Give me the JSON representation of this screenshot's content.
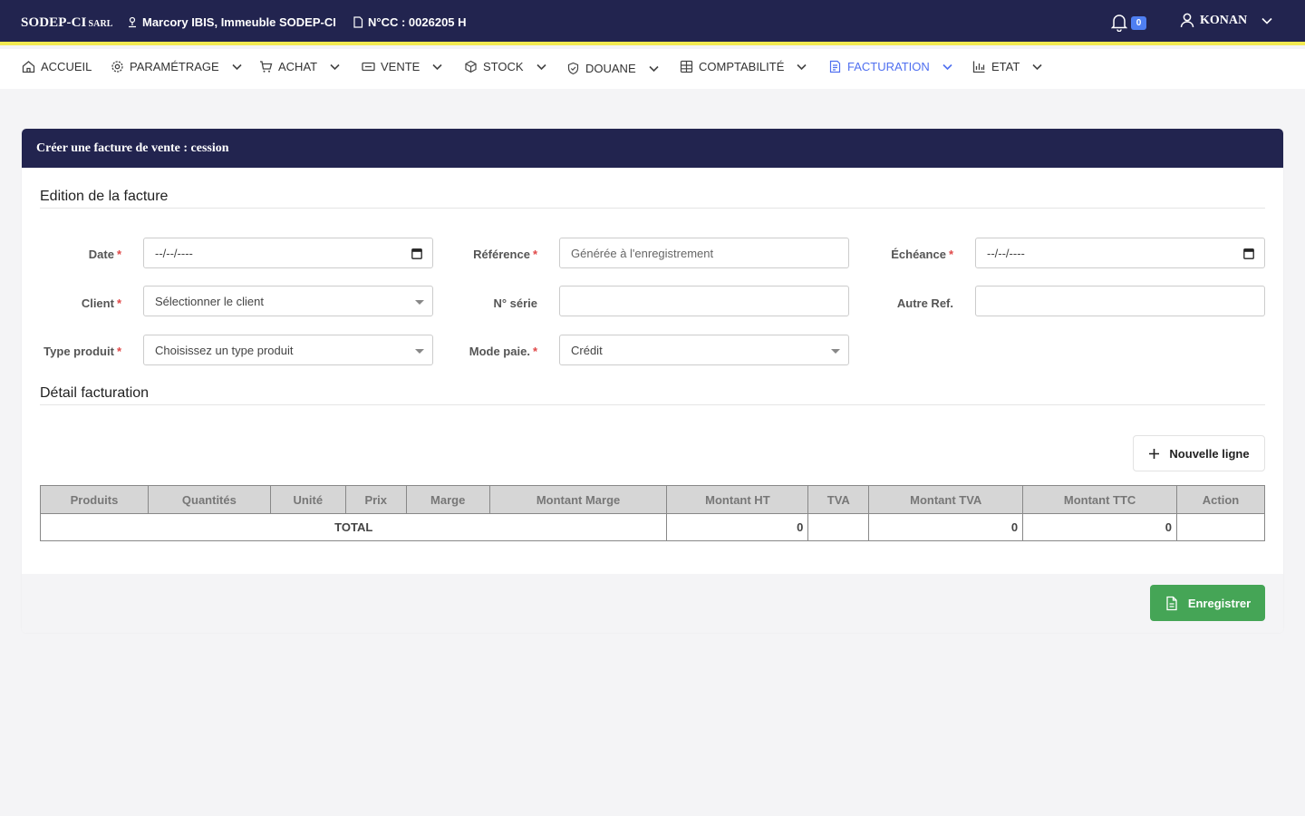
{
  "topbar": {
    "brand": "SODEP-CI",
    "brand_suffix": "SARL",
    "address": "Marcory IBIS, Immeuble SODEP-CI",
    "ncc": "N°CC : 0026205 H",
    "notification_count": "0",
    "user_name": "KONAN"
  },
  "nav": {
    "items": [
      {
        "label": "ACCUEIL",
        "icon": "home-icon"
      },
      {
        "label": "PARAMÉTRAGE",
        "icon": "settings-icon"
      },
      {
        "label": "ACHAT",
        "icon": "cart-icon"
      },
      {
        "label": "VENTE",
        "icon": "ticket-icon"
      },
      {
        "label": "STOCK",
        "icon": "box-icon"
      },
      {
        "label": "DOUANE",
        "icon": "shield-icon"
      },
      {
        "label": "COMPTABILITÉ",
        "icon": "calculator-icon"
      },
      {
        "label": "FACTURATION",
        "icon": "invoice-icon"
      },
      {
        "label": "ETAT",
        "icon": "chart-icon"
      }
    ],
    "active": "FACTURATION",
    "active_color": "#4f6ff0"
  },
  "card": {
    "title": "Créer une facture de vente : cession",
    "edition_title": "Edition de la facture",
    "detail_title": "Détail facturation"
  },
  "form": {
    "required_mark": "*",
    "date": {
      "label": "Date",
      "value": "--/--/----"
    },
    "reference": {
      "label": "Référence",
      "placeholder": "Générée à l'enregistrement"
    },
    "echeance": {
      "label": "Échéance",
      "value": "--/--/----"
    },
    "client": {
      "label": "Client",
      "value": "Sélectionner le client"
    },
    "serie": {
      "label": "N° série",
      "value": ""
    },
    "autre_ref": {
      "label": "Autre Ref.",
      "value": ""
    },
    "type_produit": {
      "label": "Type produit",
      "value": "Choisissez un type produit"
    },
    "mode_paie": {
      "label": "Mode paie.",
      "value": "Crédit"
    }
  },
  "buttons": {
    "new_line": "Nouvelle ligne",
    "save": "Enregistrer"
  },
  "table": {
    "headers": [
      "Produits",
      "Quantités",
      "Unité",
      "Prix",
      "Marge",
      "Montant Marge",
      "Montant HT",
      "TVA",
      "Montant TVA",
      "Montant TTC",
      "Action"
    ],
    "total_label": "TOTAL",
    "total_ht": "0",
    "total_tva": "0",
    "total_ttc": "0"
  },
  "colors": {
    "header_navy": "#22244f",
    "accent_yellow": "#f2ea52",
    "save_green": "#45a556",
    "required_red": "#e04848"
  }
}
